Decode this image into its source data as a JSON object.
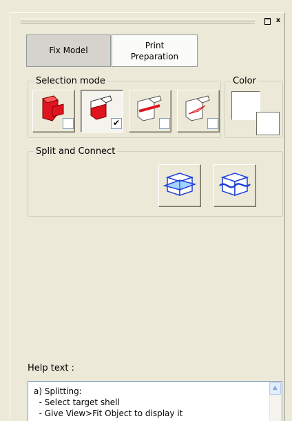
{
  "window": {
    "float_label": "",
    "close_label": "x"
  },
  "tabs": [
    {
      "label": "Fix Model"
    },
    {
      "label_line1": "Print",
      "label_line2": "Preparation"
    }
  ],
  "selection_mode": {
    "legend": "Selection mode",
    "buttons": [
      {
        "icon": "shell-select-icon",
        "checked": false
      },
      {
        "icon": "face-select-icon",
        "checked": true
      },
      {
        "icon": "edge-select-icon",
        "checked": false
      },
      {
        "icon": "triangle-select-icon",
        "checked": false
      }
    ],
    "check_mark": "✔"
  },
  "color": {
    "legend": "Color",
    "swatch": "#ffffff"
  },
  "split_connect": {
    "legend": "Split and Connect",
    "buttons": [
      {
        "icon": "split-plane-icon"
      },
      {
        "icon": "split-surface-icon"
      }
    ]
  },
  "help": {
    "label": "Help text :",
    "line1": "a) Splitting:",
    "line2": "  - Select target shell",
    "line3": "  - Give View>Fit Object to display it"
  },
  "colors": {
    "red": "#e0141e",
    "blue": "#1f3fd8",
    "panel": "#ece9d8"
  }
}
